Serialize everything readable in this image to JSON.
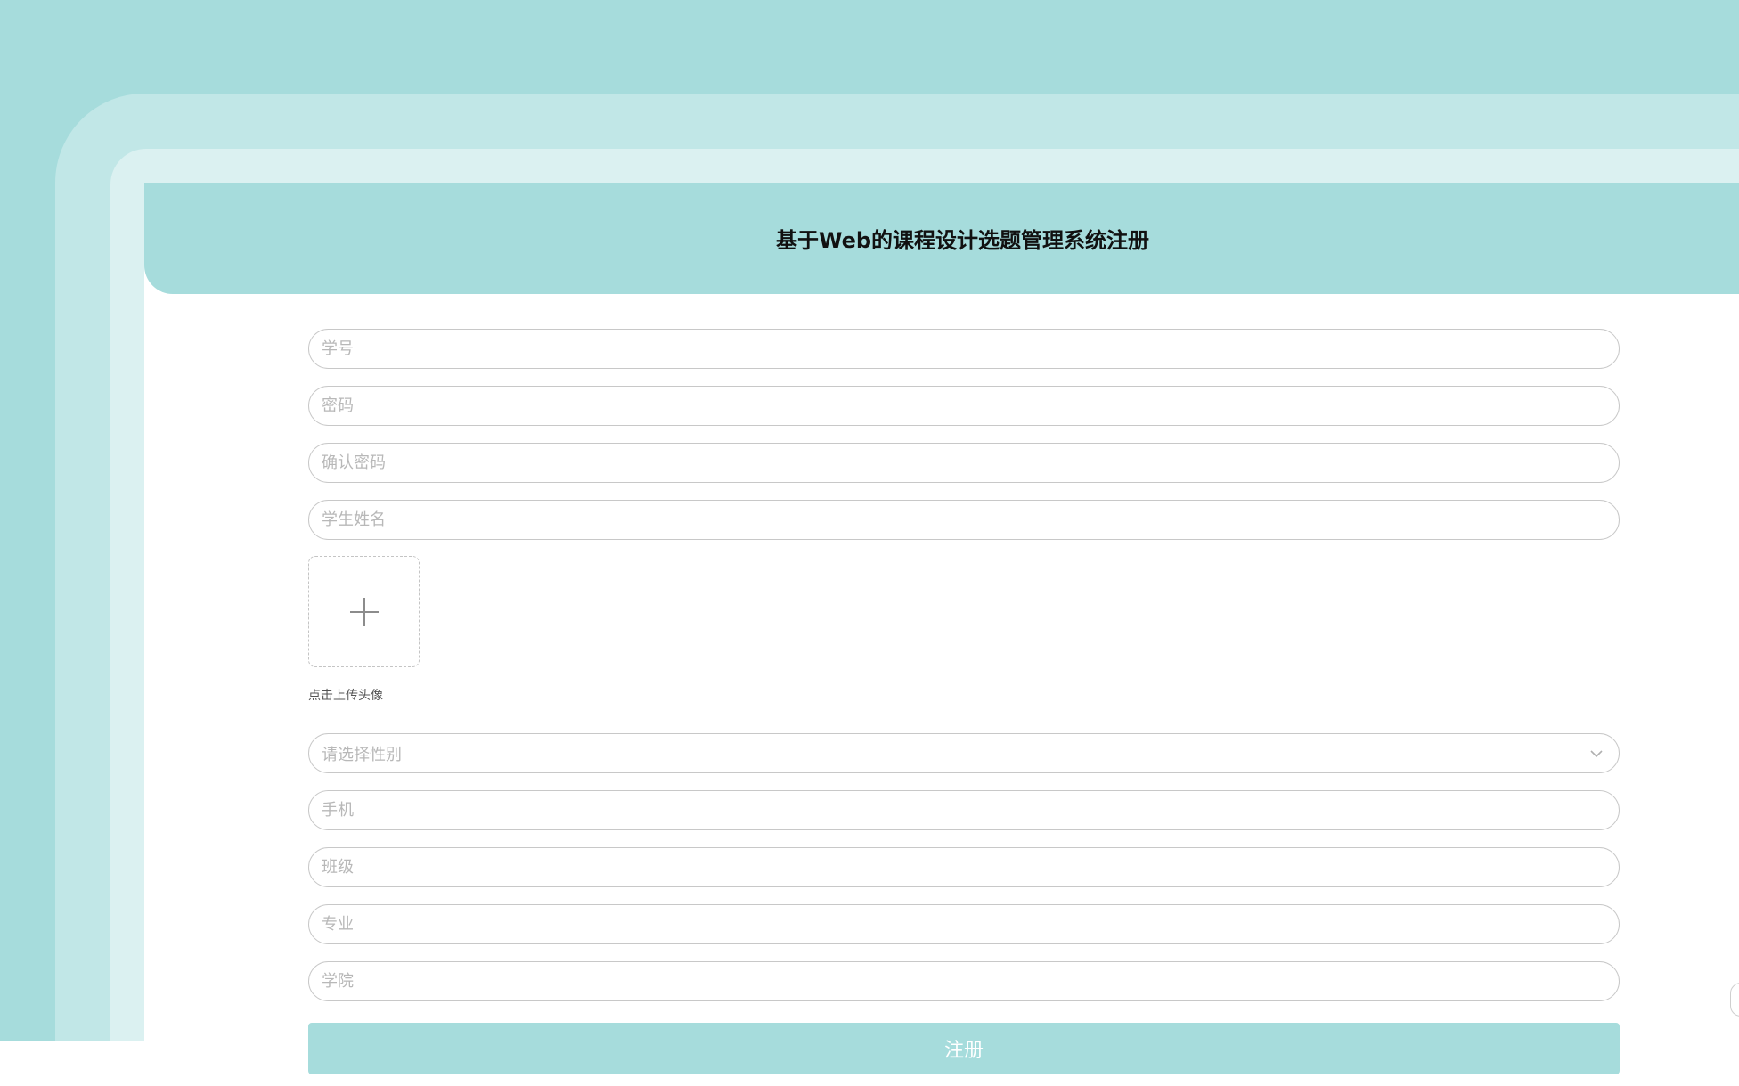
{
  "header": {
    "title": "基于Web的课程设计选题管理系统注册"
  },
  "form": {
    "student_id_placeholder": "学号",
    "password_placeholder": "密码",
    "confirm_password_placeholder": "确认密码",
    "student_name_placeholder": "学生姓名",
    "avatar_upload_label": "点击上传头像",
    "gender_placeholder": "请选择性别",
    "phone_placeholder": "手机",
    "class_placeholder": "班级",
    "major_placeholder": "专业",
    "college_placeholder": "学院",
    "submit_label": "注册"
  },
  "colors": {
    "accent": "#a6dcdc",
    "frame_light": "#c1e7e7",
    "frame_lighter": "#dbf1f1"
  },
  "icons": {
    "upload": "plus-icon",
    "select": "chevron-down-icon"
  }
}
